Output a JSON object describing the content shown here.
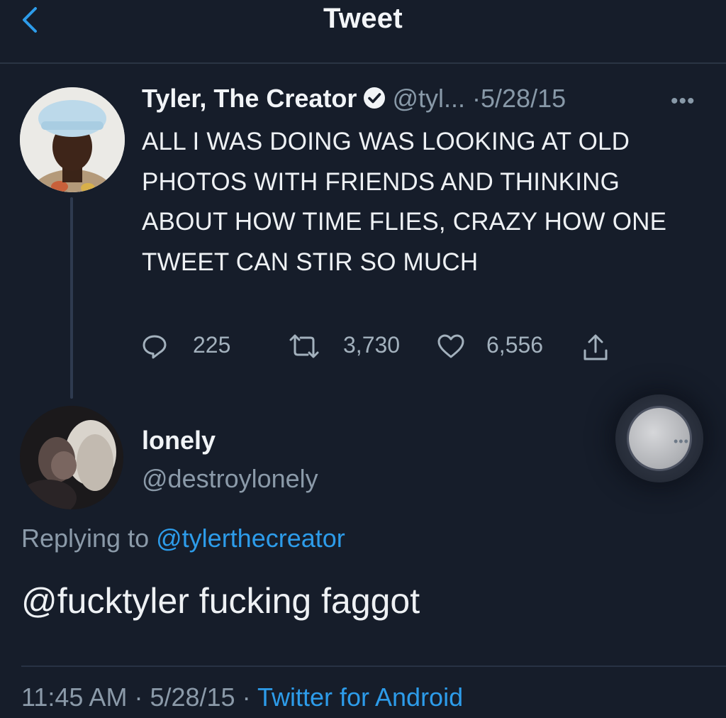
{
  "header": {
    "title": "Tweet",
    "back_icon": "chevron-left-icon"
  },
  "colors": {
    "background": "#161d2a",
    "accent": "#2d9cea",
    "secondary_text": "#8b9aa9"
  },
  "original_tweet": {
    "author_name": "Tyler, The Creator",
    "verified": true,
    "handle": "@tyl...",
    "separator": "·",
    "date": "5/28/15",
    "more_label": "•••",
    "text": "ALL I WAS DOING WAS LOOKING AT OLD PHOTOS WITH FRIENDS AND THINKING ABOUT HOW TIME FLIES, CRAZY HOW ONE TWEET CAN STIR SO MUCH",
    "actions": {
      "replies": "225",
      "retweets": "3,730",
      "likes": "6,556"
    }
  },
  "reply": {
    "author_name": "lonely",
    "handle": "@destroylonely",
    "replying_to_label": "Replying to",
    "replying_to_handle": "@tylerthecreator",
    "text": "@fucktyler fucking faggot",
    "time": "11:45 AM",
    "separator": "·",
    "date": "5/28/15",
    "source": "Twitter for Android",
    "more_label": "•••"
  }
}
